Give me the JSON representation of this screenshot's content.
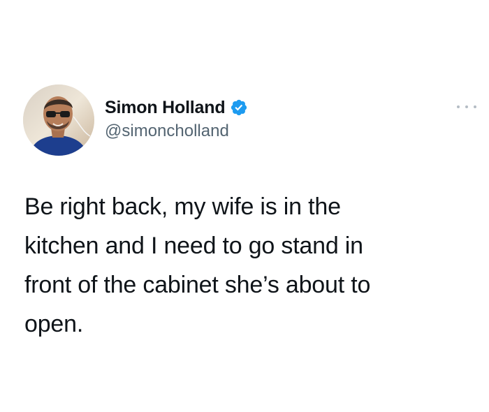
{
  "tweet": {
    "author": {
      "display_name": "Simon Holland",
      "handle": "@simoncholland",
      "verified": true,
      "avatar_icon": "profile-photo"
    },
    "more_icon": "more-horizontal-icon",
    "text_lines": [
      "Be right back, my wife is in the",
      "kitchen and I need to go stand in",
      "front of the cabinet she’s about to",
      "open."
    ]
  },
  "colors": {
    "text": "#0f1419",
    "handle": "#536471",
    "verified_blue": "#1d9bf0",
    "background": "#ffffff"
  }
}
